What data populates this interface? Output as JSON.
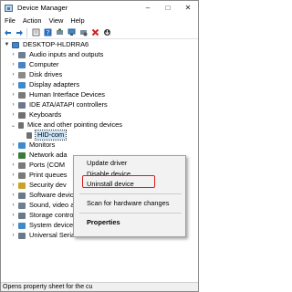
{
  "window": {
    "title": "Device Manager",
    "icon": "device-manager-icon",
    "controls": [
      "–",
      "□",
      "✕"
    ]
  },
  "menu": [
    "File",
    "Action",
    "View",
    "Help"
  ],
  "toolbar": {
    "icons": [
      "back-arrow-icon",
      "forward-arrow-icon",
      "properties-sheet-icon",
      "help-icon",
      "update-driver-icon",
      "monitor-icon",
      "disable-device-icon",
      "uninstall-x-icon",
      "scan-hardware-icon"
    ]
  },
  "tree": {
    "root": "DESKTOP-HLDRRA6",
    "items": [
      {
        "label": "Audio inputs and outputs",
        "icon": "speaker-icon",
        "color": "#6e7f93"
      },
      {
        "label": "Computer",
        "icon": "computer-icon",
        "color": "#4a82c6"
      },
      {
        "label": "Disk drives",
        "icon": "disk-drive-icon",
        "color": "#8a8a8a"
      },
      {
        "label": "Display adapters",
        "icon": "display-adapter-icon",
        "color": "#3f8ac9"
      },
      {
        "label": "Human Interface Devices",
        "icon": "hid-icon",
        "color": "#7a7a7a"
      },
      {
        "label": "IDE ATA/ATAPI controllers",
        "icon": "ide-controller-icon",
        "color": "#6a7a8a"
      },
      {
        "label": "Keyboards",
        "icon": "keyboard-icon",
        "color": "#707070"
      },
      {
        "label": "Mice and other pointing devices",
        "icon": "mouse-icon",
        "color": "#707070",
        "expanded": true
      },
      {
        "label": "HID-com",
        "icon": "mouse-icon",
        "color": "#707070",
        "child": true,
        "selected": true
      },
      {
        "label": "Monitors",
        "icon": "monitor-icon",
        "color": "#3f8ac9"
      },
      {
        "label": "Network ada",
        "icon": "network-adapter-icon",
        "color": "#3b7a3b"
      },
      {
        "label": "Ports (COM",
        "icon": "port-icon",
        "color": "#7a7a7a"
      },
      {
        "label": "Print queues",
        "icon": "printer-icon",
        "color": "#7a7a7a"
      },
      {
        "label": "Security dev",
        "icon": "security-device-icon",
        "color": "#c9a227"
      },
      {
        "label": "Software devices",
        "icon": "software-device-icon",
        "color": "#6a7a8a"
      },
      {
        "label": "Sound, video and game controllers",
        "icon": "sound-controller-icon",
        "color": "#6e7f93"
      },
      {
        "label": "Storage controllers",
        "icon": "storage-controller-icon",
        "color": "#6a7a8a"
      },
      {
        "label": "System devices",
        "icon": "system-device-icon",
        "color": "#3f8ac9"
      },
      {
        "label": "Universal Serial Bus controllers",
        "icon": "usb-icon",
        "color": "#6a7a8a"
      }
    ]
  },
  "context_menu": {
    "update_driver": "Update driver",
    "disable_device": "Disable device",
    "uninstall_device": "Uninstall device",
    "scan": "Scan for hardware changes",
    "properties": "Properties",
    "highlight_color": "#d42020"
  },
  "status": "Opens property sheet for the cu"
}
